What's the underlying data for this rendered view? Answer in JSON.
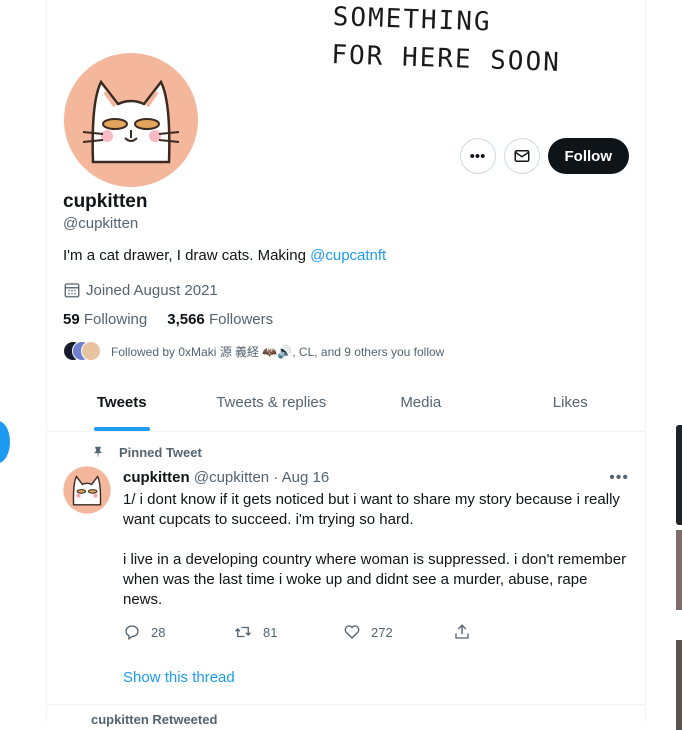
{
  "banner": {
    "text_line1": "SOMETHING",
    "text_line2": "FOR HERE SOON"
  },
  "profile": {
    "display_name": "cupkitten",
    "handle": "@cupkitten",
    "bio_text": "I'm a cat drawer, I draw cats. Making ",
    "bio_link": "@cupcatnft",
    "joined": "Joined August 2021",
    "following_count": "59",
    "following_label": "Following",
    "followers_count": "3,566",
    "followers_label": "Followers",
    "followed_by": "Followed by 0xMaki 源 義経 🦇🔊, CL, and 9 others you follow"
  },
  "actions": {
    "more_icon": "more-icon",
    "message_icon": "mail-icon",
    "follow_label": "Follow"
  },
  "tabs": [
    {
      "label": "Tweets",
      "active": true
    },
    {
      "label": "Tweets & replies",
      "active": false
    },
    {
      "label": "Media",
      "active": false
    },
    {
      "label": "Likes",
      "active": false
    }
  ],
  "tweet": {
    "pinned_label": "Pinned Tweet",
    "author_name": "cupkitten",
    "author_handle": "@cupkitten",
    "separator": " · ",
    "date": "Aug 16",
    "paragraph1": "1/ i dont know if it gets noticed but i want to share my story because i really want cupcats to succeed. i'm trying so hard.",
    "paragraph2": "i live in a developing country where woman is suppressed. i don't remember when was the last time i woke up and didnt see a murder, abuse, rape news.",
    "reply_count": "28",
    "retweet_count": "81",
    "like_count": "272",
    "show_thread": "Show this thread"
  },
  "next_tweet": {
    "retweet_label": "cupkitten Retweeted"
  },
  "colors": {
    "accent": "#1d9bf0",
    "text": "#0f1419",
    "muted": "#536471",
    "avatar_bg": "#f4b79c"
  }
}
